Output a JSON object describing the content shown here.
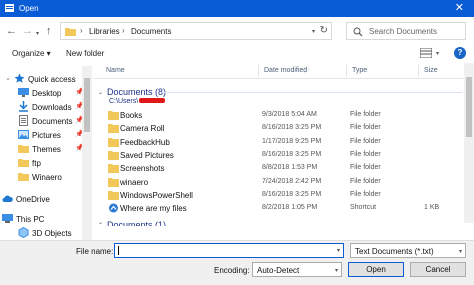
{
  "window": {
    "title": "Open"
  },
  "address": {
    "crumbs": [
      "Libraries",
      "Documents"
    ],
    "search_placeholder": "Search Documents"
  },
  "toolbar": {
    "organize": "Organize ▾",
    "new_folder": "New folder"
  },
  "nav": {
    "items": [
      {
        "label": "Quick access",
        "icon": "star-icon",
        "pinned": false
      },
      {
        "label": "Desktop",
        "icon": "desktop-icon",
        "pinned": true
      },
      {
        "label": "Downloads",
        "icon": "download-icon",
        "pinned": true
      },
      {
        "label": "Documents",
        "icon": "documents-icon",
        "pinned": true
      },
      {
        "label": "Pictures",
        "icon": "pictures-icon",
        "pinned": true
      },
      {
        "label": "Themes",
        "icon": "folder-icon",
        "pinned": true
      },
      {
        "label": "ftp",
        "icon": "folder-icon",
        "pinned": false
      },
      {
        "label": "Winaero",
        "icon": "folder-icon",
        "pinned": false
      },
      {
        "label": "OneDrive",
        "icon": "cloud-icon",
        "pinned": false
      },
      {
        "label": "This PC",
        "icon": "computer-icon",
        "pinned": false
      },
      {
        "label": "3D Objects",
        "icon": "cube-icon",
        "pinned": false
      }
    ]
  },
  "columns": {
    "name": "Name",
    "date": "Date modified",
    "type": "Type",
    "size": "Size"
  },
  "group": {
    "header": "Documents (8)",
    "path": "C:\\Users\\"
  },
  "files": [
    {
      "name": "Books",
      "date": "9/3/2018 5:04 AM",
      "type": "File folder",
      "size": ""
    },
    {
      "name": "Camera Roll",
      "date": "8/16/2018 3:25 PM",
      "type": "File folder",
      "size": ""
    },
    {
      "name": "FeedbackHub",
      "date": "1/17/2018 9:25 PM",
      "type": "File folder",
      "size": ""
    },
    {
      "name": "Saved Pictures",
      "date": "8/16/2018 3:25 PM",
      "type": "File folder",
      "size": ""
    },
    {
      "name": "Screenshots",
      "date": "8/8/2018 1:53 PM",
      "type": "File folder",
      "size": ""
    },
    {
      "name": "winaero",
      "date": "7/24/2018 2:42 PM",
      "type": "File folder",
      "size": ""
    },
    {
      "name": "WindowsPowerShell",
      "date": "8/16/2018 3:25 PM",
      "type": "File folder",
      "size": ""
    },
    {
      "name": "Where are my files",
      "date": "8/2/2018 1:05 PM",
      "type": "Shortcut",
      "size": "1 KB"
    }
  ],
  "group2": {
    "header": "Documents (1)"
  },
  "bottom": {
    "filename_label": "File name:",
    "filename_value": "",
    "filetype": "Text Documents (*.txt)",
    "encoding_label": "Encoding:",
    "encoding": "Auto-Detect",
    "open": "Open",
    "cancel": "Cancel"
  },
  "colors": {
    "accent": "#0a5bd6",
    "folder": "#f3c85b",
    "group_text": "#1e3287"
  }
}
